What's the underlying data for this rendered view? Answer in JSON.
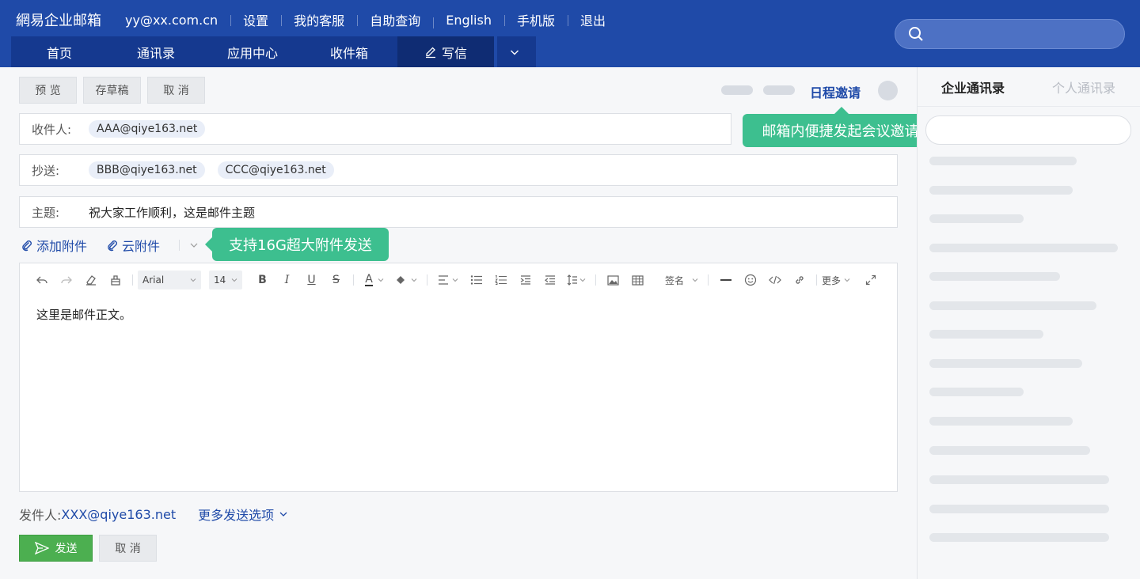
{
  "header": {
    "brand": "網易企业邮箱",
    "links": [
      "yy@xx.com.cn",
      "设置",
      "我的客服",
      "自助查询",
      "English",
      "手机版",
      "退出"
    ],
    "tabs": [
      "首页",
      "通讯录",
      "应用中心",
      "收件箱"
    ],
    "write_tab": "写信",
    "search_placeholder": ""
  },
  "actions": {
    "preview": "预 览",
    "save_draft": "存草稿",
    "cancel": "取 消",
    "schedule_invite": "日程邀请"
  },
  "tips": {
    "schedule": "邮箱内便捷发起会议邀请",
    "attachment": "支持16G超大附件发送"
  },
  "compose": {
    "to_label": "收件人:",
    "to": [
      "AAA@qiye163.net"
    ],
    "cc_label": "抄送:",
    "cc": [
      "BBB@qiye163.net",
      "CCC@qiye163.net"
    ],
    "subject_label": "主题:",
    "subject": "祝大家工作顺利，这是邮件主题",
    "add_attachment": "添加附件",
    "cloud_attachment": "云附件",
    "body": "这里是邮件正文。"
  },
  "toolbar": {
    "font_family": "Arial",
    "font_size": "14",
    "signature": "签名",
    "more": "更多"
  },
  "footer": {
    "sender_label": "发件人:",
    "sender_email": "XXX@qiye163.net",
    "more_options": "更多发送选项",
    "send": "发送",
    "cancel": "取 消"
  },
  "contacts": {
    "tab_enterprise": "企业通讯录",
    "tab_personal": "个人通讯录"
  },
  "colors": {
    "header_bg": "#1f4aa8",
    "tip_green": "#3dbf8f",
    "send_green": "#4caf50",
    "link_blue": "#1f4aa8"
  }
}
